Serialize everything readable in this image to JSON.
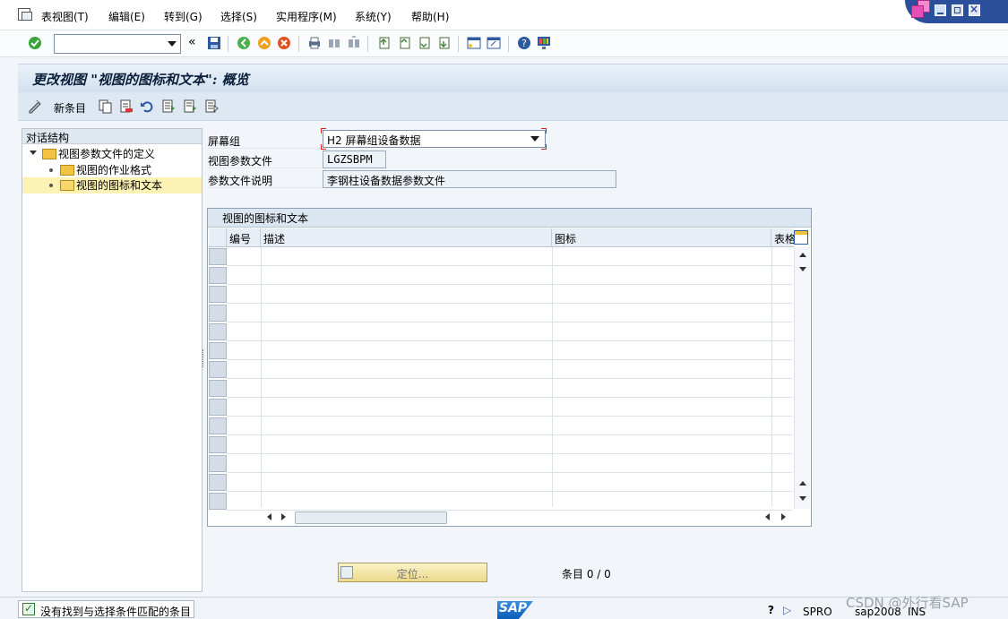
{
  "menu": {
    "items": [
      "表视图(T)",
      "编辑(E)",
      "转到(G)",
      "选择(S)",
      "实用程序(M)",
      "系统(Y)",
      "帮助(H)"
    ]
  },
  "toolbar": {
    "command_value": "",
    "icons": [
      "enter-icon",
      "save-icon",
      "back-icon",
      "exit-icon",
      "cancel-icon",
      "print-icon",
      "find-icon",
      "find-next-icon",
      "first-page-icon",
      "previous-page-icon",
      "next-page-icon",
      "last-page-icon",
      "create-session-icon",
      "shortcut-icon",
      "help-icon",
      "customize-icon"
    ]
  },
  "title": "更改视图 \"视图的图标和文本\": 概览",
  "app_toolbar": {
    "new_entries_label": "新条目"
  },
  "tree": {
    "header": "对话结构",
    "root": "视图参数文件的定义",
    "children": [
      "视图的作业格式",
      "视图的图标和文本"
    ]
  },
  "fields": {
    "screen_group_label": "屏幕组",
    "screen_group_value": "H2 屏幕组设备数据",
    "view_param_label": "视图参数文件",
    "view_param_value": "LGZSBPM",
    "param_desc_label": "参数文件说明",
    "param_desc_value": "李钢柱设备数据参数文件"
  },
  "table": {
    "caption": "视图的图标和文本",
    "columns": [
      "编号",
      "描述",
      "图标",
      "表格"
    ]
  },
  "position_button": "定位...",
  "entry_count": "条目 0 / 0",
  "status": {
    "message": "没有找到与选择条件匹配的条目",
    "transaction": "SPRO",
    "server": "sap2008",
    "mode": "INS",
    "logo": "SAP"
  },
  "watermark": "CSDN @外行看SAP"
}
